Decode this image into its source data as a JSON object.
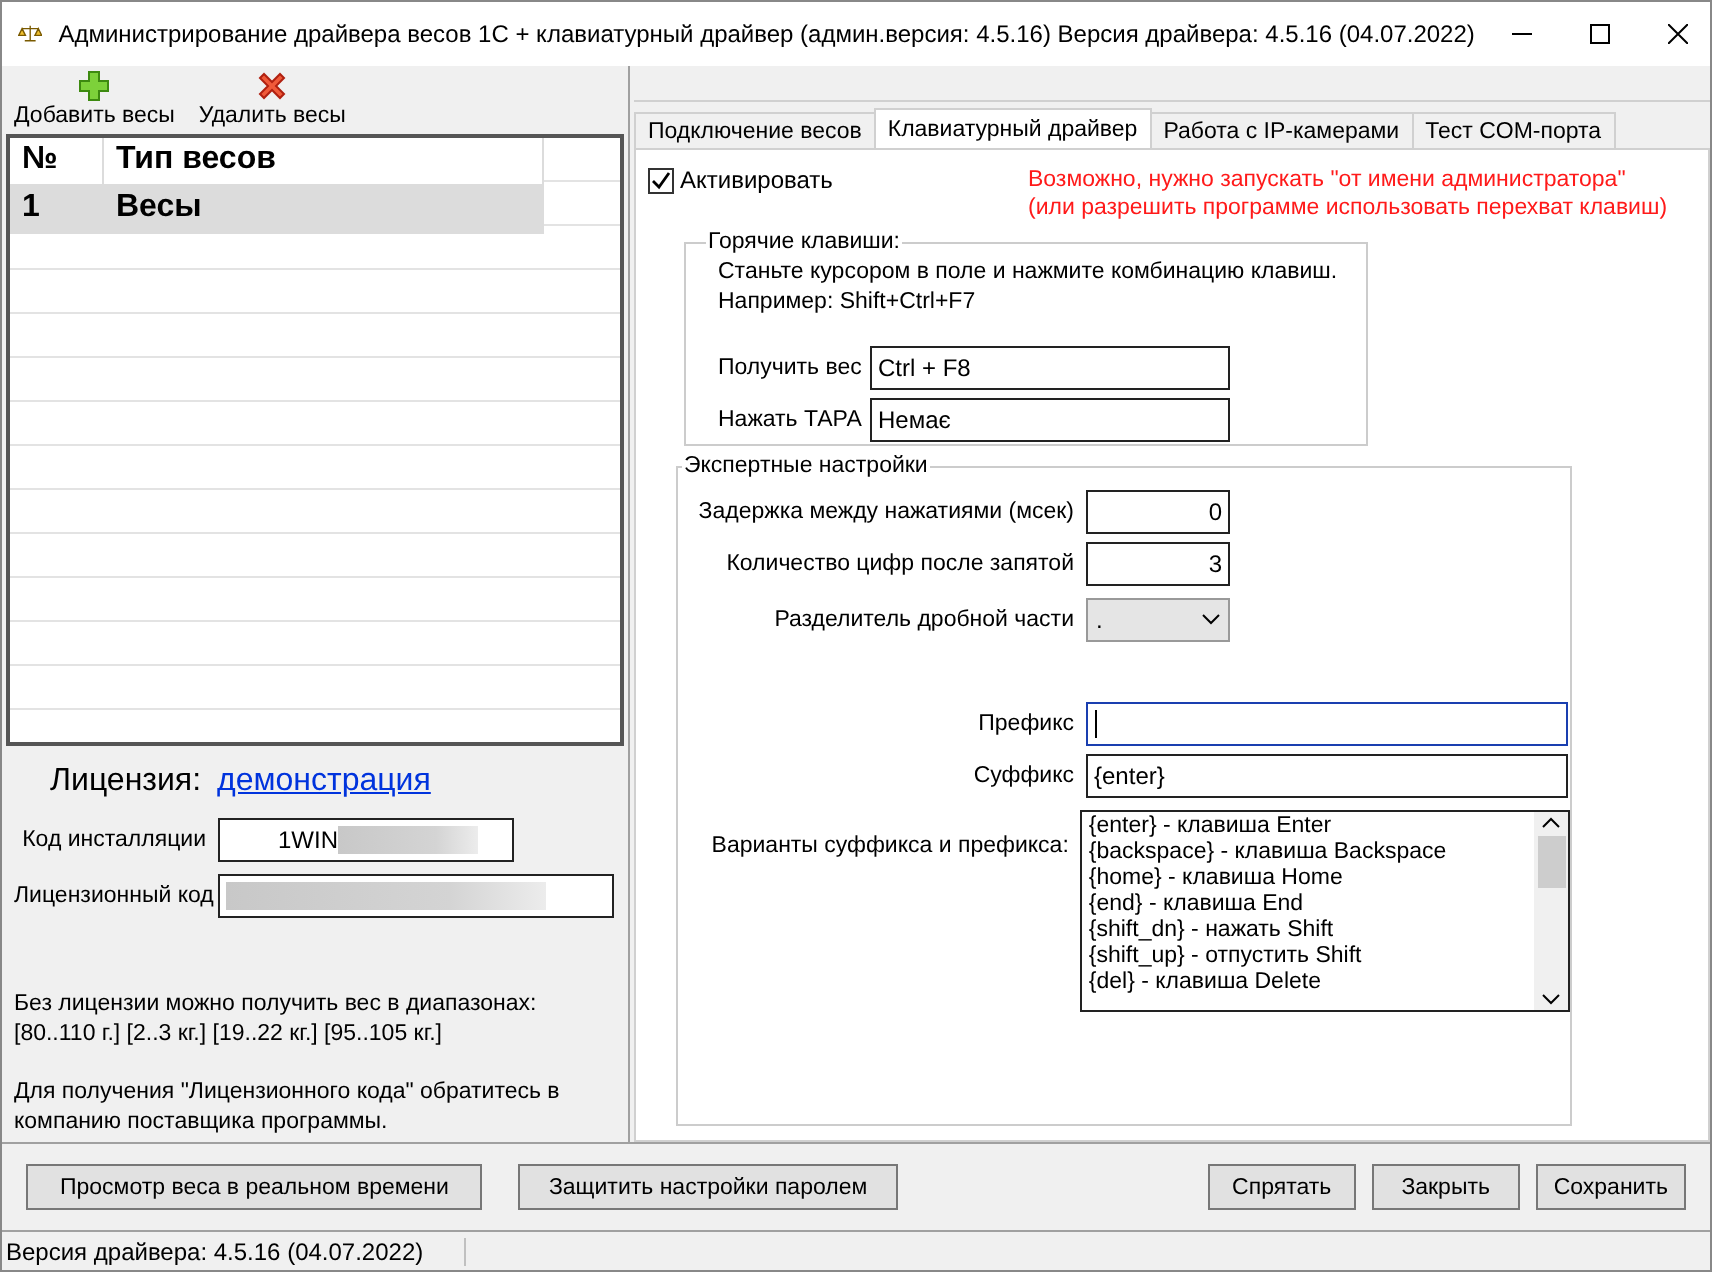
{
  "window": {
    "title": "Администрирование драйвера весов 1С + клавиатурный драйвер  (админ.версия: 4.5.16) Версия драйвера: 4.5.16 (04.07.2022)"
  },
  "toolbar": [
    {
      "kind": "add",
      "label": "Добавить весы"
    },
    {
      "kind": "remove",
      "label": "Удалить весы"
    }
  ],
  "scales_table": {
    "columns": [
      "№",
      "Тип весов"
    ],
    "rows": [
      {
        "cells": [
          "1",
          "Весы"
        ],
        "selected": true
      }
    ]
  },
  "license": {
    "label": "Лицензия:",
    "status": "демонстрация",
    "install_code": {
      "label": "Код инсталляции",
      "value": "1WIN"
    },
    "license_code": {
      "label": "Лицензионный код"
    },
    "notes": [
      [
        "Без лицензии можно получить вес в диапазонах:",
        "[80..110 г.]  [2..3 кг.]  [19..22 кг.]  [95..105 кг.]"
      ],
      [
        "Для получения \"Лицензионного кода\" обратитесь в",
        "компанию поставщика программы."
      ]
    ]
  },
  "tabs": [
    {
      "label": "Подключение весов",
      "selected": false
    },
    {
      "label": "Клавиатурный драйвер",
      "selected": true
    },
    {
      "label": "Работа с IP-камерами",
      "selected": false
    },
    {
      "label": "Тест COM-порта",
      "selected": false
    }
  ],
  "keyboard": {
    "activate": {
      "label": "Активировать",
      "checked": true
    },
    "warning": [
      "Возможно, нужно запускать \"от имени администратора\"",
      "(или разрешить программе использовать перехват клавиш)"
    ],
    "hotkeys": {
      "title": "Горячие клавиши:",
      "hint": [
        "Станьте курсором в поле и нажмите комбинацию клавиш.",
        "Например: Shift+Ctrl+F7"
      ],
      "fields": [
        {
          "label": "Получить вес",
          "value": "Ctrl + F8"
        },
        {
          "label": "Нажать ТАРА",
          "value": "Немає"
        }
      ]
    },
    "expert": {
      "title": "Экспертные настройки",
      "fields": [
        {
          "kind": "number",
          "label": "Задержка между нажатиями (мсек)",
          "value": "0"
        },
        {
          "kind": "number",
          "label": "Количество цифр после запятой",
          "value": "3"
        },
        {
          "kind": "dropdown",
          "label": "Разделитель дробной части",
          "value": "."
        }
      ],
      "prefix": {
        "label": "Префикс",
        "focused": true
      },
      "suffix": {
        "label": "Суффикс",
        "value": "{enter}"
      },
      "variants": {
        "label": "Варианты суффикса и префикса:",
        "items": [
          "{enter} - клавиша Enter",
          "{backspace} - клавиша Backspace",
          "{home} - клавиша Home",
          "{end} - клавиша End",
          "{shift_dn} - нажать Shift",
          "{shift_up} - отпустить Shift",
          "{del} - клавиша Delete"
        ]
      }
    }
  },
  "buttons_left": [
    "Просмотр веса в реальном времени",
    "Защитить настройки паролем"
  ],
  "buttons_right": [
    "Спрятать",
    "Закрыть",
    "Сохранить"
  ],
  "status_bar": "Версия драйвера: 4.5.16 (04.07.2022)"
}
